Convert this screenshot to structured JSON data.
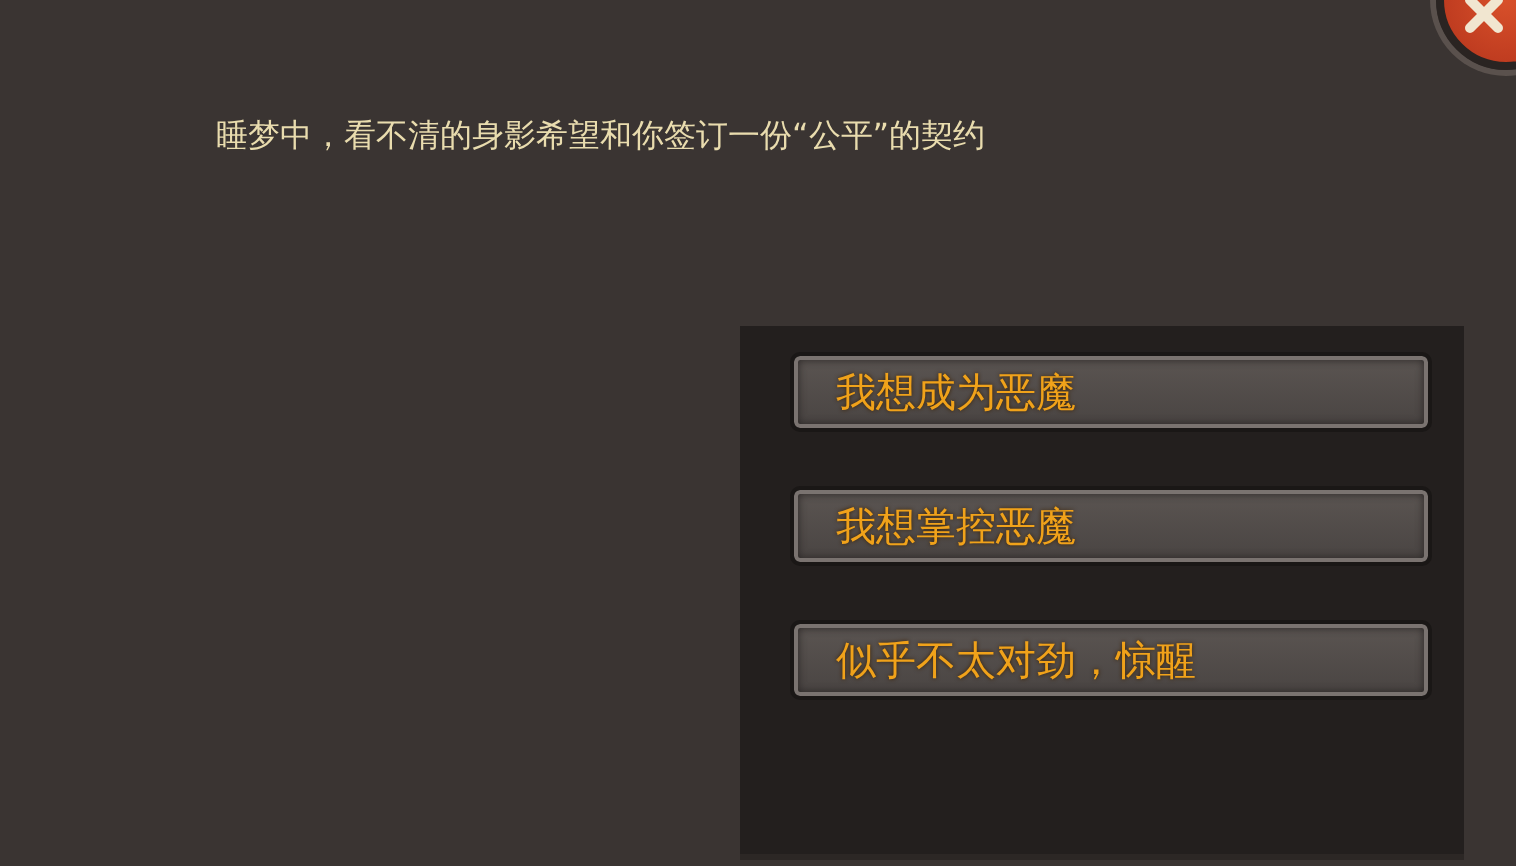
{
  "dialog": {
    "text": "睡梦中，看不清的身影希望和你签订一份“公平”的契约"
  },
  "options": [
    {
      "label": "我想成为恶魔"
    },
    {
      "label": "我想掌控恶魔"
    },
    {
      "label": "似乎不太对劲，惊醒"
    }
  ]
}
